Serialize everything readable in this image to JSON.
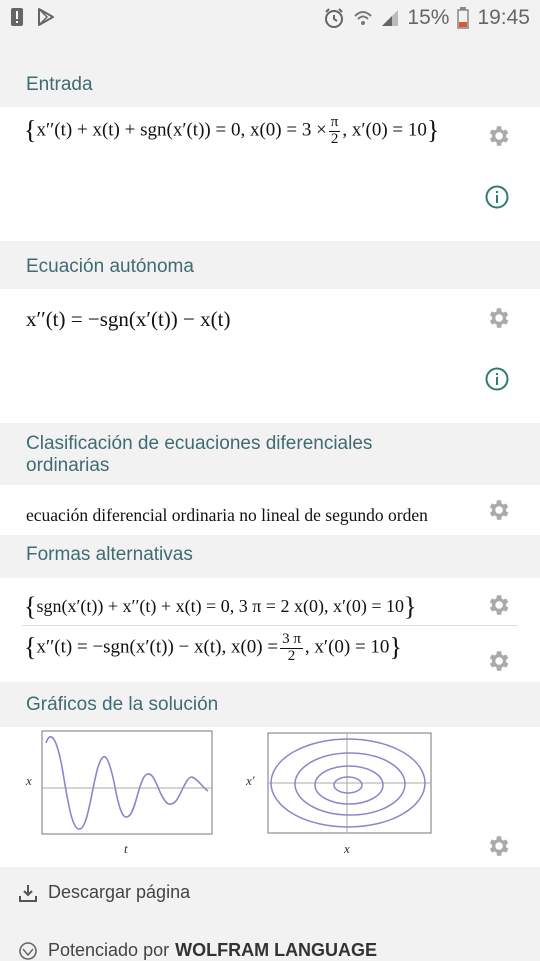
{
  "status": {
    "battery": "15%",
    "time": "19:45"
  },
  "pods": {
    "input": {
      "title": "Entrada",
      "eq_main": "x′′(t) + x(t) + sgn(x′(t)) = 0, x(0) = 3 ×",
      "frac_n": "π",
      "frac_d": "2",
      "eq_tail": ", x′(0) = 10"
    },
    "autonomous": {
      "title": "Ecuación autónoma",
      "eq": "x′′(t) = −sgn(x′(t)) − x(t)"
    },
    "classification": {
      "title": "Clasificación de ecuaciones diferenciales ordinarias",
      "text": "ecuación diferencial ordinaria no lineal de segundo orden"
    },
    "alternatives": {
      "title": "Formas alternativas",
      "alt1": "sgn(x′(t)) + x′′(t) + x(t) = 0, 3 π = 2 x(0), x′(0) = 10",
      "alt2_main": "x′′(t) = −sgn(x′(t)) − x(t), x(0) =",
      "alt2_n": "3 π",
      "alt2_d": "2",
      "alt2_tail": ", x′(0) = 10"
    },
    "plots": {
      "title": "Gráficos de la solución",
      "p1_ylabel": "x",
      "p1_xlabel": "t",
      "p2_ylabel": "x′",
      "p2_xlabel": "x"
    }
  },
  "footer": {
    "download": "Descargar página",
    "powered_prefix": "Potenciado por",
    "powered_brand": "WOLFRAM LANGUAGE"
  },
  "colors": {
    "accent": "#3f6b73",
    "icon": "#aaaaaa",
    "curve": "#8a86c9",
    "info": "#2e7d6f"
  }
}
